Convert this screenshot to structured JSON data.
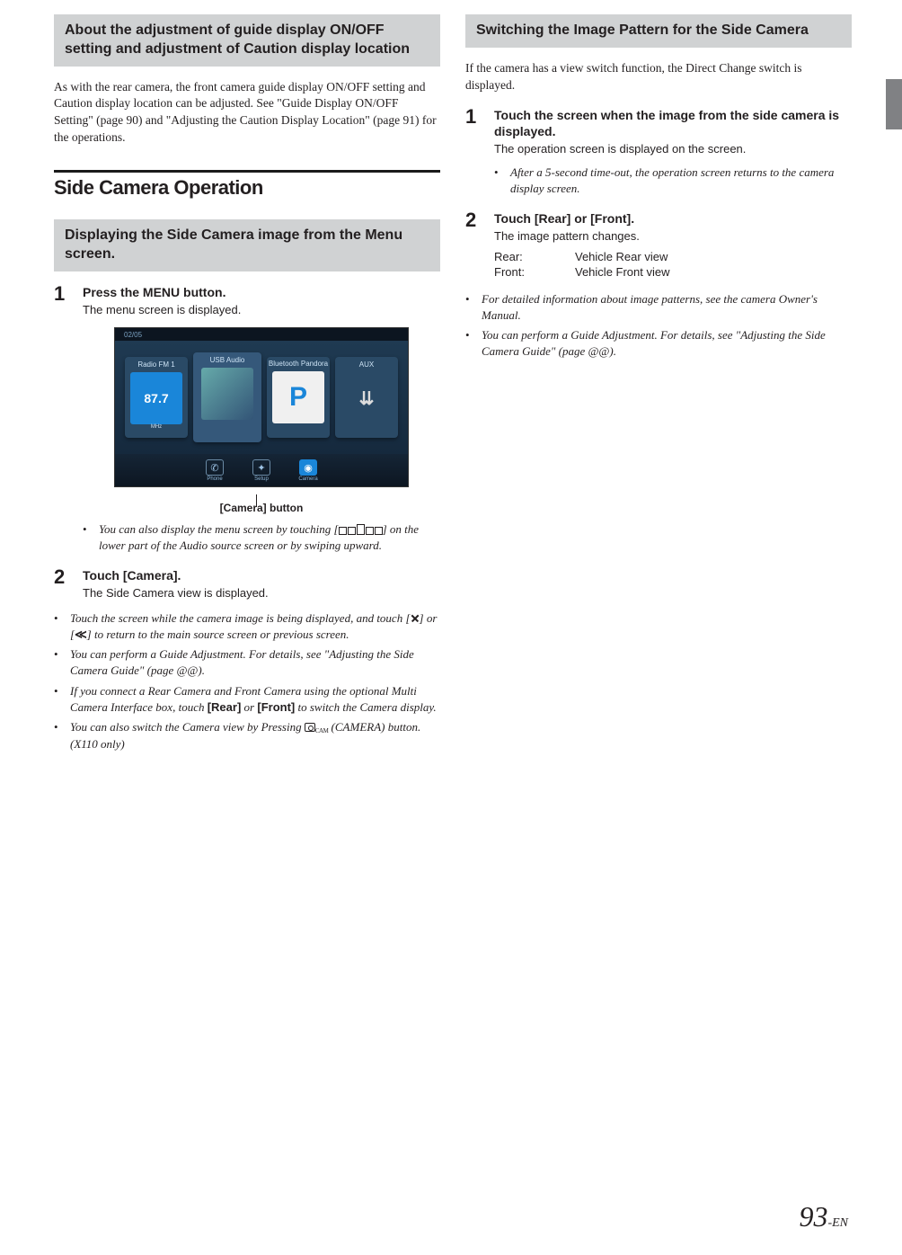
{
  "left": {
    "shade1_title": "About the adjustment of guide display ON/OFF setting and adjustment of Caution display location",
    "para1": "As with the rear camera, the front camera guide display ON/OFF setting and Caution display location can be adjusted. See \"Guide Display ON/OFF Setting\" (page 90) and \"Adjusting the Caution Display Location\" (page 91) for the operations.",
    "section_title": "Side Camera Operation",
    "shade2_title": "Displaying the Side Camera image from the Menu screen.",
    "step1_lead": "Press the MENU button.",
    "step1_sub": "The menu screen is displayed.",
    "menu_shot": {
      "track": "02/05",
      "tiles": {
        "radio_label": "Radio FM 1",
        "radio_freq": "87.7",
        "radio_unit": "MHz",
        "usb_label": "USB Audio",
        "bt_label": "Bluetooth Pandora",
        "aux_label": "AUX"
      },
      "bottom": {
        "phone": "Phone",
        "setup": "Setup",
        "camera": "Camera"
      }
    },
    "callout_label": "[Camera] button",
    "step1_note": "You can also display the menu screen by touching [",
    "step1_note_tail": "] on the lower part of the Audio source screen or by swiping upward.",
    "step2_lead_pre": "Touch [",
    "step2_lead_btn": "Camera",
    "step2_lead_post": "].",
    "step2_sub": "The Side Camera view is displayed.",
    "bullets2": [
      {
        "pre": "Touch the screen while the camera image is being displayed, and touch [",
        "mid": "] or [",
        "post": "] to return to the main source screen or previous screen."
      },
      {
        "text": "You can perform a Guide Adjustment. For details, see \"Adjusting the Side Camera Guide\" (page @@)."
      },
      {
        "pre": "If you connect a Rear Camera and Front Camera using the optional Multi Camera Interface box, touch ",
        "b1": "[Rear]",
        "mid": " or ",
        "b2": "[Front]",
        "post": " to switch the Camera display."
      },
      {
        "pre": "You can also switch the Camera view by Pressing ",
        "post": " (CAMERA) button. (X110 only)"
      }
    ]
  },
  "right": {
    "shade_title": "Switching the Image Pattern for the Side Camera",
    "para": "If the camera has a view switch function, the Direct Change switch is displayed.",
    "step1_lead": "Touch the screen when the image from the side camera is displayed.",
    "step1_sub": "The operation screen is displayed on the screen.",
    "step1_note": "After a 5-second time-out, the operation screen returns to the camera display screen.",
    "step2_lead_pre": "Touch [",
    "step2_b1": "Rear",
    "step2_mid": "] or [",
    "step2_b2": "Front",
    "step2_post": "].",
    "step2_sub": "The image pattern changes.",
    "defs": [
      {
        "k": "Rear:",
        "v": "Vehicle Rear view"
      },
      {
        "k": "Front:",
        "v": "Vehicle Front view"
      }
    ],
    "bullets": [
      "For detailed information about image patterns, see the camera Owner's Manual.",
      "You can perform a Guide Adjustment. For details, see \"Adjusting the Side Camera Guide\" (page @@)."
    ]
  },
  "page_number": "93",
  "page_suffix": "-EN"
}
